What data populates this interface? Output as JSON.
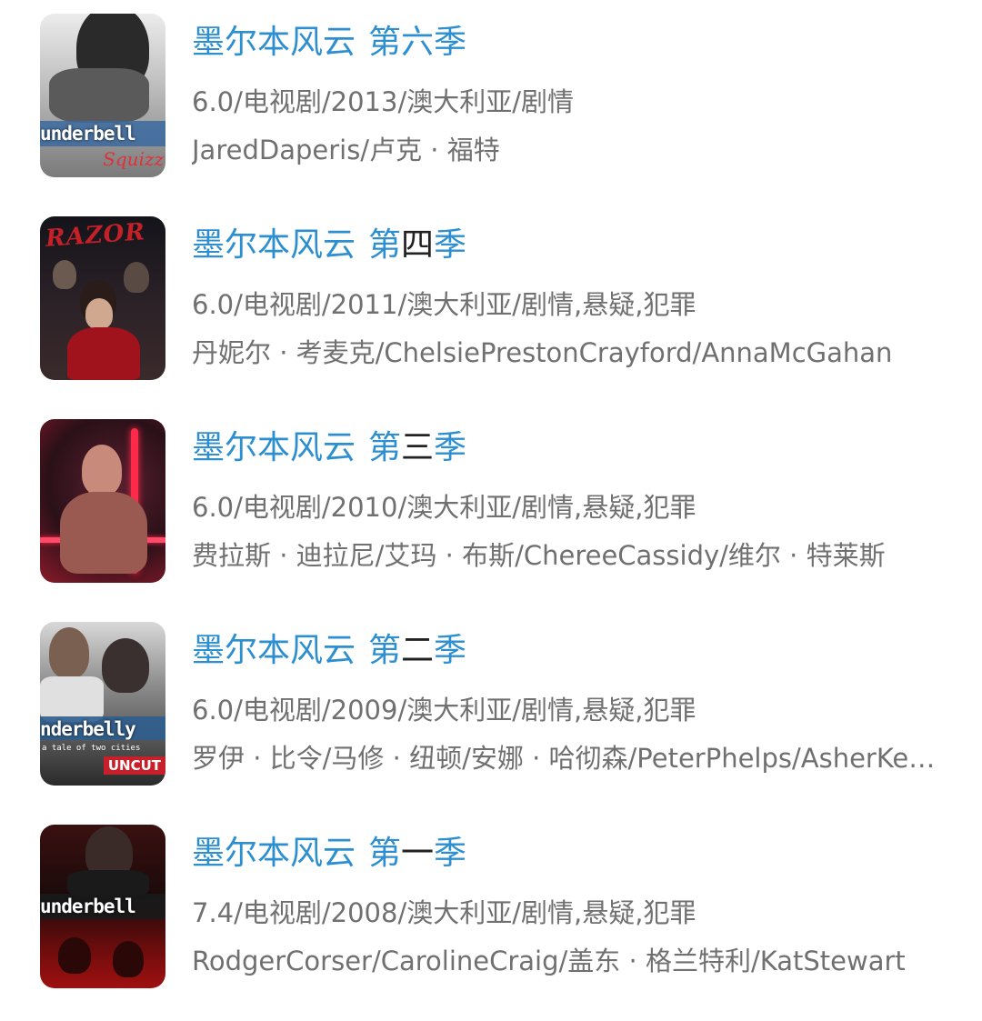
{
  "items": [
    {
      "title_prefix": "墨尔本风云",
      "title_season": "第六季",
      "season_pre": "第",
      "season_num": "六",
      "season_post": "季",
      "meta": "6.0/电视剧/2013/澳大利亚/剧情",
      "cast": "JaredDaperis/卢克 · 福特",
      "poster": {
        "logo_text": "underbell",
        "script_text": "Squizz",
        "colors": {
          "bg_top": "#e6e6e6",
          "bg_bottom": "#8a8a8a",
          "accent": "#d32a34",
          "band": "#3b6aa0"
        }
      }
    },
    {
      "title_prefix": "墨尔本风云",
      "season_pre": "第",
      "season_num": "四",
      "season_post": "季",
      "meta": "6.0/电视剧/2011/澳大利亚/剧情,悬疑,犯罪",
      "cast": "丹妮尔 · 考麦克/ChelsiePrestonCrayford/AnnaMcGahan",
      "poster": {
        "razor_text": "RAZOR",
        "colors": {
          "bg_top": "#1a1a22",
          "bg_bottom": "#3a2a2a",
          "accent": "#b01c24",
          "dress": "#a0121c"
        }
      }
    },
    {
      "title_prefix": "墨尔本风云",
      "season_pre": "第",
      "season_num": "三",
      "season_post": "季",
      "meta": "6.0/电视剧/2010/澳大利亚/剧情,悬疑,犯罪",
      "cast": "费拉斯 · 迪拉尼/艾玛 · 布斯/ChereeCassidy/维尔 · 特莱斯",
      "poster": {
        "colors": {
          "bg_top": "#2a1018",
          "bg_bottom": "#8a1a2a",
          "accent": "#ff2a4a",
          "skin": "#c88a7a"
        }
      }
    },
    {
      "title_prefix": "墨尔本风云",
      "season_pre": "第",
      "season_num": "二",
      "season_post": "季",
      "meta": "6.0/电视剧/2009/澳大利亚/剧情,悬疑,犯罪",
      "cast": "罗伊 · 比令/马修 · 纽顿/安娜 · 哈彻森/PeterPhelps/AsherKeddie",
      "poster": {
        "logo_text": "nderbelly",
        "tagline_text": "a tale of two cities",
        "badge_text": "UNCUT",
        "colors": {
          "bg_top": "#d8d8d8",
          "bg_bottom": "#2a2a2a",
          "accent": "#c8202a",
          "band": "#2f5e8e"
        }
      }
    },
    {
      "title_prefix": "墨尔本风云",
      "season_pre": "第",
      "season_num": "一",
      "season_post": "季",
      "meta": "7.4/电视剧/2008/澳大利亚/剧情,悬疑,犯罪",
      "cast": "RodgerCorser/CarolineCraig/盖东 · 格兰特利/KatStewart",
      "poster": {
        "logo_text": "underbell",
        "colors": {
          "bg_top": "#2a0a0a",
          "bg_bottom": "#6a0c0c",
          "accent": "#d01818",
          "band": "#1a1a1a"
        }
      }
    }
  ],
  "colors": {
    "title_blue": "#2d8fd0",
    "season_number": "#222222",
    "meta_gray": "#707070",
    "background": "#ffffff"
  }
}
